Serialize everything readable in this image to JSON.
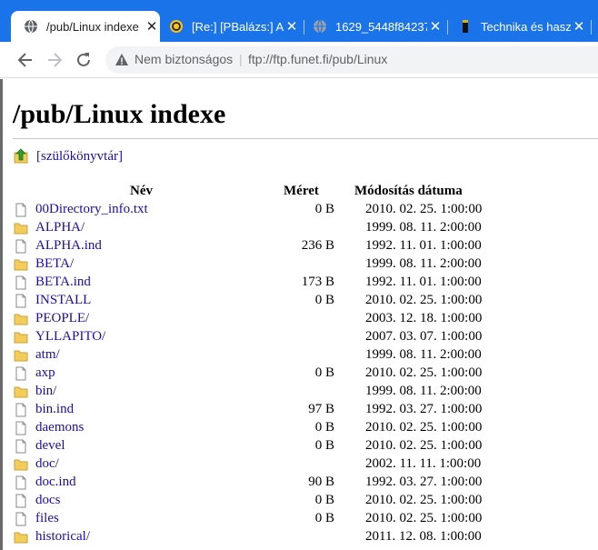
{
  "browser": {
    "tabs": [
      {
        "title": "/pub/Linux indexe",
        "icon": "globe-icon",
        "active": true
      },
      {
        "title": "[Re:] [PBalázs:] A g",
        "icon": "chat-icon",
        "active": false
      },
      {
        "title": "1629_5448f84237",
        "icon": "globe-icon",
        "active": false
      },
      {
        "title": "Technika és haszn",
        "icon": "bookmark-icon",
        "active": false
      }
    ],
    "security_label": "Nem biztonságos",
    "separator": "|",
    "url": "ftp://ftp.funet.fi/pub/Linux",
    "accent_color": "#1a73e8"
  },
  "page": {
    "title": "/pub/Linux indexe",
    "parent_link": "[szülőkönyvtár]",
    "columns": {
      "name": "Név",
      "size": "Méret",
      "modified": "Módosítás dátuma"
    },
    "entries": [
      {
        "name": "00Directory_info.txt",
        "type": "file",
        "size": "0 B",
        "date": "2010. 02. 25. 1:00:00"
      },
      {
        "name": "ALPHA/",
        "type": "folder",
        "size": "",
        "date": "1999. 08. 11. 2:00:00"
      },
      {
        "name": "ALPHA.ind",
        "type": "file",
        "size": "236 B",
        "date": "1992. 11. 01. 1:00:00"
      },
      {
        "name": "BETA/",
        "type": "folder",
        "size": "",
        "date": "1999. 08. 11. 2:00:00"
      },
      {
        "name": "BETA.ind",
        "type": "file",
        "size": "173 B",
        "date": "1992. 11. 01. 1:00:00"
      },
      {
        "name": "INSTALL",
        "type": "file",
        "size": "0 B",
        "date": "2010. 02. 25. 1:00:00"
      },
      {
        "name": "PEOPLE/",
        "type": "folder",
        "size": "",
        "date": "2003. 12. 18. 1:00:00"
      },
      {
        "name": "YLLAPITO/",
        "type": "folder",
        "size": "",
        "date": "2007. 03. 07. 1:00:00"
      },
      {
        "name": "atm/",
        "type": "folder",
        "size": "",
        "date": "1999. 08. 11. 2:00:00"
      },
      {
        "name": "axp",
        "type": "file",
        "size": "0 B",
        "date": "2010. 02. 25. 1:00:00"
      },
      {
        "name": "bin/",
        "type": "folder",
        "size": "",
        "date": "1999. 08. 11. 2:00:00"
      },
      {
        "name": "bin.ind",
        "type": "file",
        "size": "97 B",
        "date": "1992. 03. 27. 1:00:00"
      },
      {
        "name": "daemons",
        "type": "file",
        "size": "0 B",
        "date": "2010. 02. 25. 1:00:00"
      },
      {
        "name": "devel",
        "type": "file",
        "size": "0 B",
        "date": "2010. 02. 25. 1:00:00"
      },
      {
        "name": "doc/",
        "type": "folder",
        "size": "",
        "date": "2002. 11. 11. 1:00:00"
      },
      {
        "name": "doc.ind",
        "type": "file",
        "size": "90 B",
        "date": "1992. 03. 27. 1:00:00"
      },
      {
        "name": "docs",
        "type": "file",
        "size": "0 B",
        "date": "2010. 02. 25. 1:00:00"
      },
      {
        "name": "files",
        "type": "file",
        "size": "0 B",
        "date": "2010. 02. 25. 1:00:00"
      },
      {
        "name": "historical/",
        "type": "folder",
        "size": "",
        "date": "2011. 12. 08. 1:00:00"
      }
    ]
  }
}
